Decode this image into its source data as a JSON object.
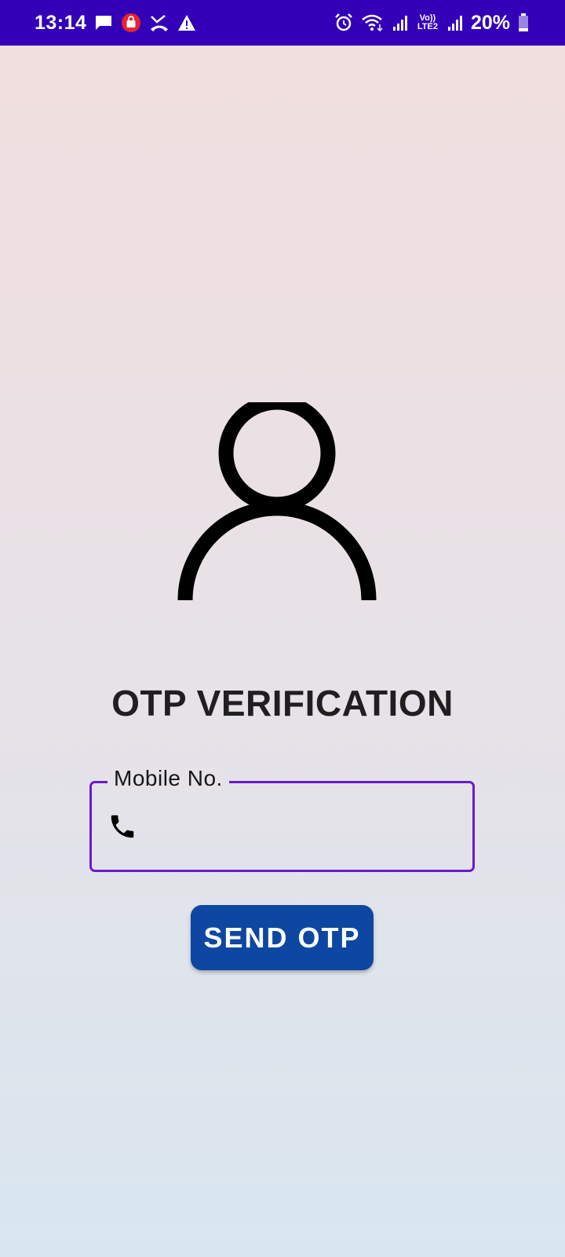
{
  "status_bar": {
    "time": "13:14",
    "battery_percent": "20%",
    "network_label": "Vo)) LTE2",
    "battery_level": 0.2,
    "icons": [
      "message-icon",
      "shop-bag-icon",
      "missed-call-icon",
      "warning-icon",
      "alarm-icon",
      "wifi-icon",
      "signal-icon",
      "lte-icon",
      "signal-icon",
      "battery-icon"
    ],
    "background_color": "#3300b8"
  },
  "avatar": {
    "icon": "user-avatar-icon"
  },
  "title": "OTP VERIFICATION",
  "mobile_field": {
    "label": "Mobile No.",
    "value": "",
    "icon": "phone-icon",
    "border_color": "#6a1ad1"
  },
  "send_button": {
    "label": "SEND OTP",
    "color": "#0d47a1"
  }
}
